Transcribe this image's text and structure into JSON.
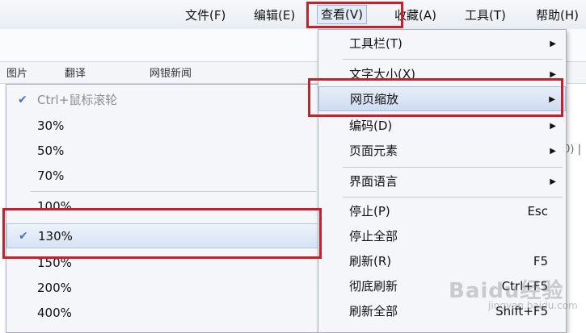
{
  "menubar": {
    "items": [
      "文件(F)",
      "编辑(E)",
      "查看(V)",
      "收藏(A)",
      "工具(T)",
      "帮助(H)"
    ]
  },
  "toolstrip": {
    "items": [
      "图片",
      "翻译",
      "网银新闻"
    ]
  },
  "bg_text": "0) |",
  "view_menu": {
    "items": [
      {
        "label": "工具栏(T)",
        "shortcut": "",
        "submenu": true
      },
      {
        "label": "文字大小(X)",
        "shortcut": "",
        "submenu": true
      },
      {
        "label": "网页缩放",
        "shortcut": "",
        "submenu": true
      },
      {
        "label": "编码(D)",
        "shortcut": "",
        "submenu": true
      },
      {
        "label": "页面元素",
        "shortcut": "",
        "submenu": true
      },
      {
        "label": "界面语言",
        "shortcut": "",
        "submenu": true
      },
      {
        "label": "停止(P)",
        "shortcut": "Esc",
        "submenu": false
      },
      {
        "label": "停止全部",
        "shortcut": "",
        "submenu": false
      },
      {
        "label": "刷新(R)",
        "shortcut": "F5",
        "submenu": false
      },
      {
        "label": "彻底刷新",
        "shortcut": "Ctrl+F5",
        "submenu": false
      },
      {
        "label": "刷新全部",
        "shortcut": "Shift+F5",
        "submenu": false
      }
    ]
  },
  "zoom_menu": {
    "items": [
      {
        "label": "Ctrl+鼠标滚轮",
        "checked": true,
        "disabled": true
      },
      {
        "label": "30%",
        "checked": false
      },
      {
        "label": "50%",
        "checked": false
      },
      {
        "label": "70%",
        "checked": false
      },
      {
        "label": "100%",
        "checked": false
      },
      {
        "label": "130%",
        "checked": true
      },
      {
        "label": "150%",
        "checked": false
      },
      {
        "label": "200%",
        "checked": false
      },
      {
        "label": "400%",
        "checked": false
      }
    ]
  },
  "watermark": {
    "main": "Baidu经验",
    "sub": "jingyan.baidu.com"
  },
  "icons": {
    "check": "check-icon",
    "submenu": "submenu-arrow-icon"
  },
  "colors": {
    "highlight_box": "#c8202a",
    "menu_bg": "#f4f6f9",
    "hover_bg": "#cfdcef"
  }
}
